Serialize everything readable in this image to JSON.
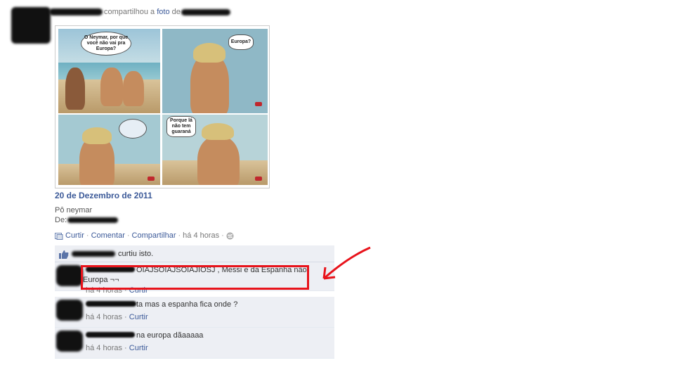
{
  "story": {
    "action_text": "compartilhou a",
    "photo_link": "foto",
    "of_text": "de"
  },
  "photo": {
    "panel1_bubble": "O Neymar, por que você não vai pra Europa?",
    "panel2_bubble": "Europa?",
    "panel4_bubble": "Porque lá não tem guaraná",
    "date": "20 de Dezembro de 2011",
    "caption_line1": "Pô neymar",
    "caption_line2": "De:"
  },
  "actions": {
    "like": "Curtir",
    "comment": "Comentar",
    "share": "Compartilhar",
    "time": "há 4 horas",
    "dot": "·"
  },
  "likes": {
    "text": "curtiu isto."
  },
  "comments": [
    {
      "body": "OIAJSOIAJSOIAJIOSJ , Messi e da Espanha não Europa ¬¬",
      "time": "há 4 horas",
      "like": "Curtir"
    },
    {
      "body": "ta mas a espanha fica onde ?",
      "time": "há 4 horas",
      "like": "Curtir"
    },
    {
      "body": "na europa dãaaaaa",
      "time": "há 4 horas",
      "like": "Curtir"
    }
  ],
  "colors": {
    "link": "#3b5998",
    "highlight": "#e8131b",
    "feedback_bg": "#edeff4"
  },
  "icons": [
    "share-photo-icon",
    "globe-icon",
    "like-thumb-icon",
    "arrow-icon"
  ]
}
